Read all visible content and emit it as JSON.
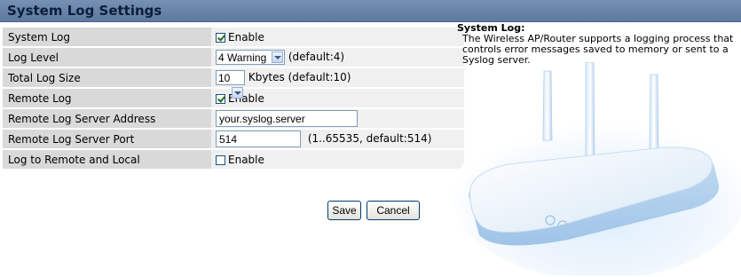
{
  "page": {
    "title": "System Log Settings"
  },
  "rows": {
    "system_log": {
      "label": "System Log",
      "checkbox_label": "Enable",
      "checked": true
    },
    "log_level": {
      "label": "Log Level",
      "selected": "4 Warning",
      "hint": "(default:4)"
    },
    "total_log_size": {
      "label": "Total Log Size",
      "selected": "10",
      "hint": "Kbytes (default:10)"
    },
    "remote_log": {
      "label": "Remote Log",
      "checkbox_label": "Enable",
      "checked": true
    },
    "remote_server_address": {
      "label": "Remote Log Server Address",
      "value": "your.syslog.server"
    },
    "remote_server_port": {
      "label": "Remote Log Server Port",
      "value": "514",
      "hint": "(1..65535, default:514)"
    },
    "log_remote_and_local": {
      "label": "Log to Remote and Local",
      "checkbox_label": "Enable",
      "checked": false
    }
  },
  "buttons": {
    "save": "Save",
    "cancel": "Cancel"
  },
  "help": {
    "title": "System Log:",
    "body": "The Wireless AP/Router supports a logging process that controls error messages saved to memory or sent to a Syslog server."
  },
  "colors": {
    "title_bar": "#6a85aa",
    "label_cell": "#d9d9d9",
    "value_cell": "#f0f0f0"
  },
  "icons": {
    "illustration": "wireless-router-illustration"
  }
}
